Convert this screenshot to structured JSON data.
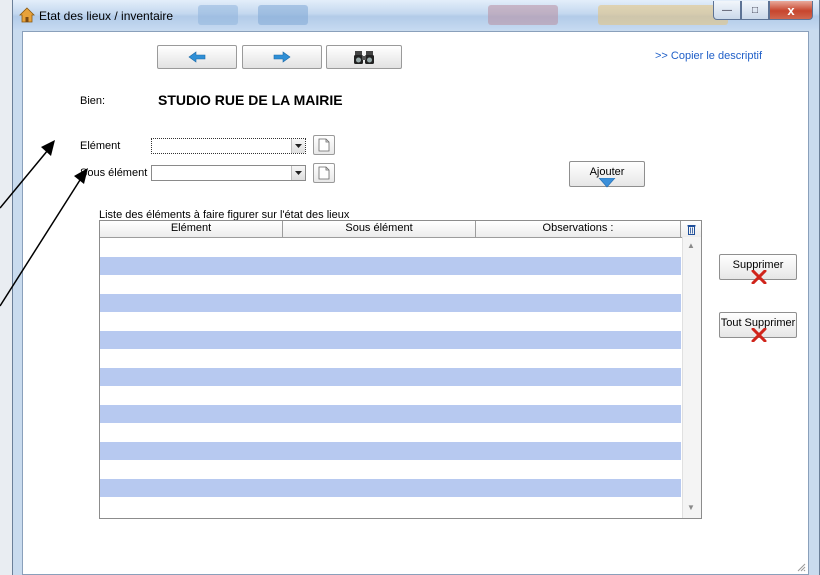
{
  "window": {
    "title": "Etat des lieux / inventaire",
    "controls": {
      "minimize": "—",
      "maximize": "□",
      "close": "x"
    }
  },
  "toolbar": {
    "prev_icon": "arrow-left-icon",
    "next_icon": "arrow-right-icon",
    "search_icon": "binoculars-icon",
    "copy_link": ">> Copier le descriptif"
  },
  "form": {
    "bien_label": "Bien:",
    "bien_value": "STUDIO RUE DE LA MAIRIE",
    "element_label": "Elément",
    "element_value": "",
    "sous_element_label": "Sous élément",
    "sous_element_value": "",
    "add_button": "Ajouter"
  },
  "list": {
    "caption": "Liste des éléments à faire figurer sur l'état des lieux",
    "columns": [
      "Elément",
      "Sous élément",
      "Observations :"
    ],
    "rows": []
  },
  "actions": {
    "delete": "Supprimer",
    "delete_all": "Tout Supprimer"
  },
  "colors": {
    "row_alt": "#b7c9f0",
    "link": "#1f5fc8",
    "nav_arrow": "#2f8fd6",
    "delete_x": "#d0241b"
  }
}
